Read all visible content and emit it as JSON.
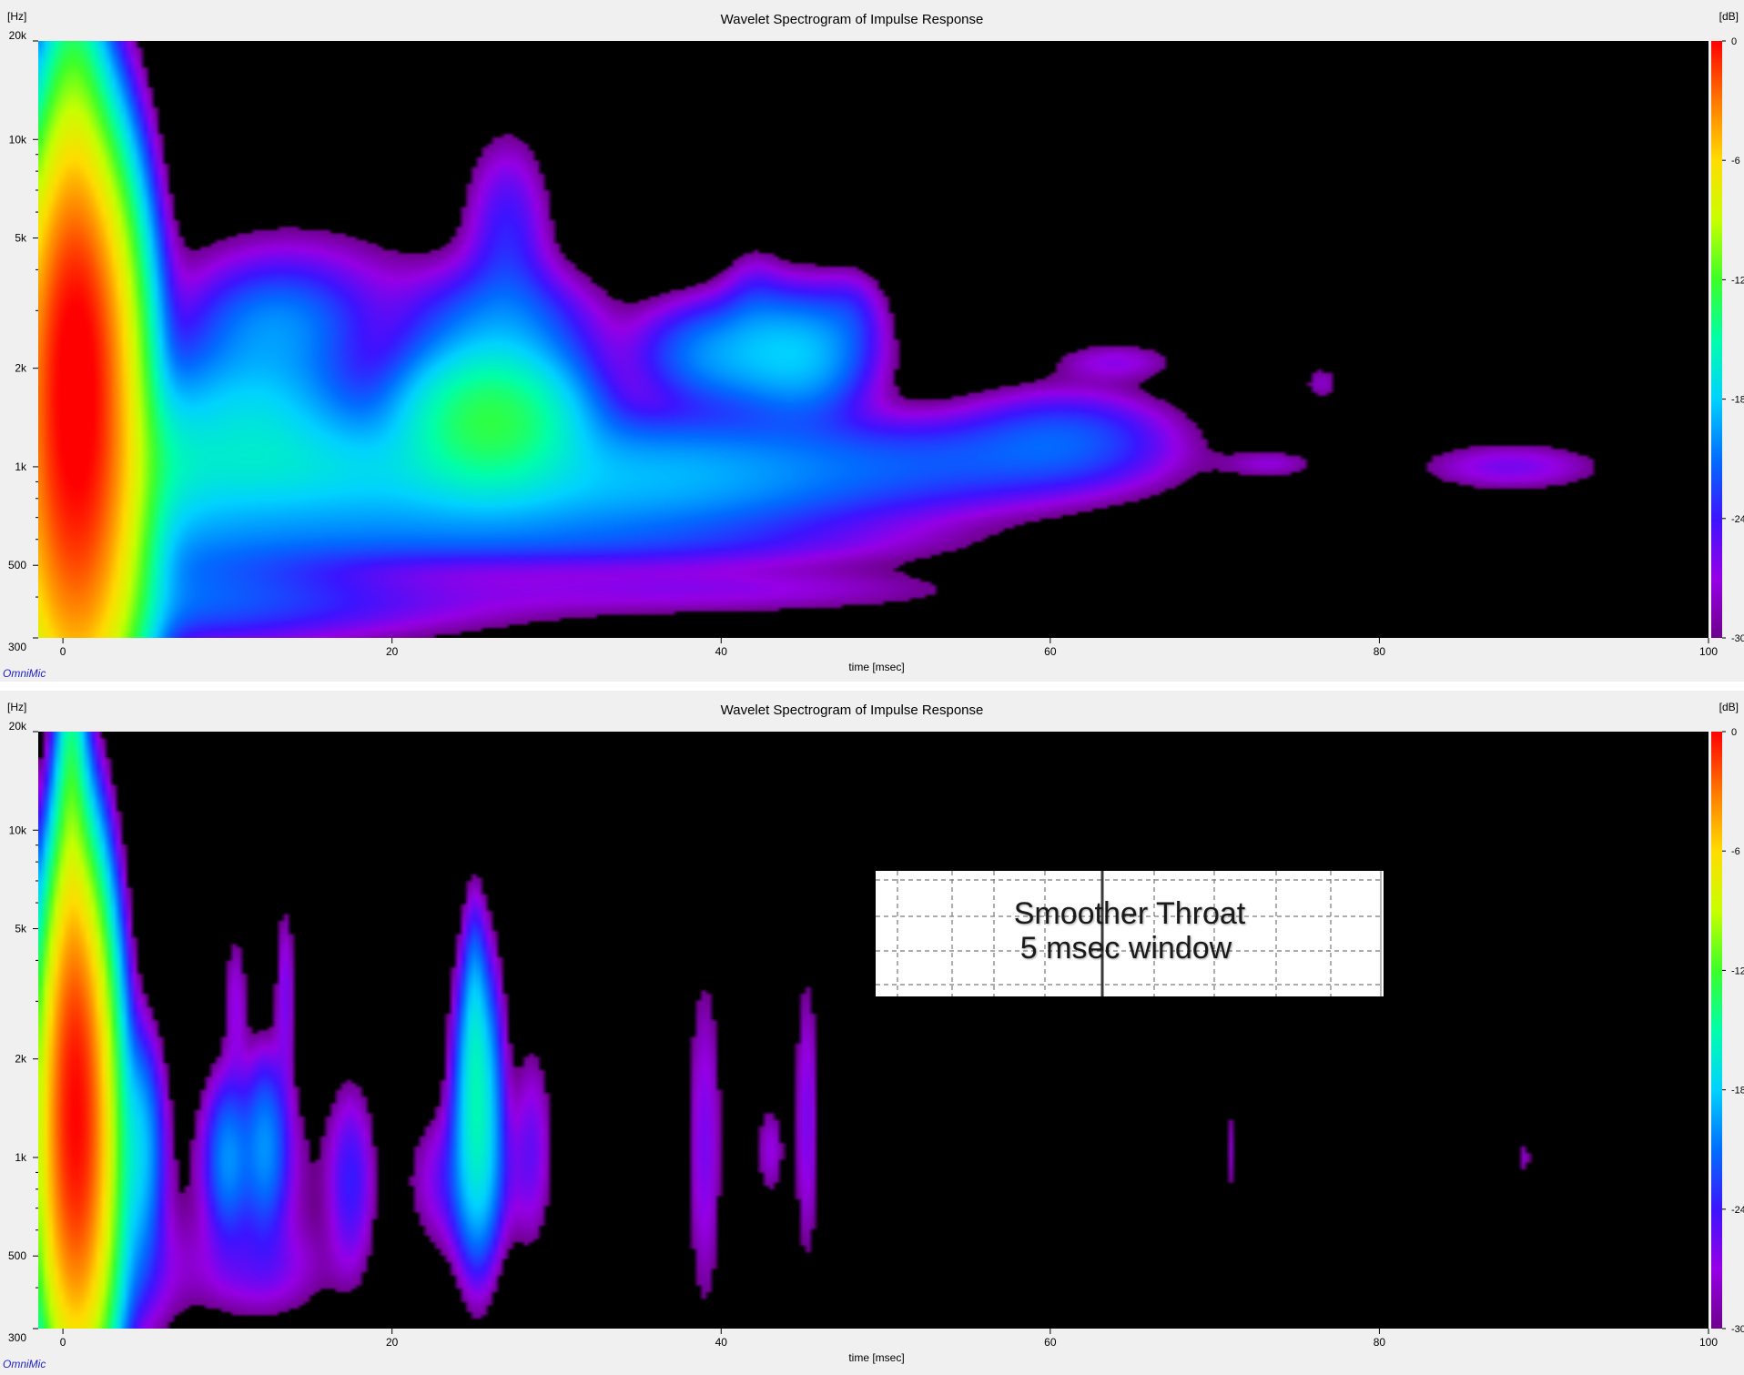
{
  "chart_data": [
    {
      "type": "heatmap",
      "title": "Wavelet Spectrogram of Impulse Response",
      "xlabel": "time [msec]",
      "ylabel": "[Hz]",
      "colorbar_label": "[dB]",
      "xlim": [
        -1.5,
        100
      ],
      "ylim": [
        300,
        20000
      ],
      "yscale": "log",
      "xticks": [
        0,
        20,
        40,
        60,
        80,
        100
      ],
      "yticks": [
        {
          "v": 20000,
          "label": "20k"
        },
        {
          "v": 10000,
          "label": "10k"
        },
        {
          "v": 5000,
          "label": "5k"
        },
        {
          "v": 2000,
          "label": "2k"
        },
        {
          "v": 1000,
          "label": "1k"
        },
        {
          "v": 500,
          "label": "500"
        },
        {
          "v": 300,
          "label": "300"
        }
      ],
      "colorbar_ticks": [
        0,
        -6,
        -12,
        -18,
        -24,
        -30
      ],
      "colorbar_range": [
        -30,
        0
      ],
      "watermark": "OmniMic",
      "features": [
        {
          "t": 0.8,
          "f": 1150,
          "dt": 1.8,
          "df": 0.4,
          "db": -1
        },
        {
          "t": 0.8,
          "f": 2500,
          "dt": 1.6,
          "df": 0.28,
          "db": -3
        },
        {
          "t": 0.8,
          "f": 650,
          "dt": 2.2,
          "df": 0.3,
          "db": -10
        },
        {
          "t": 0.6,
          "f": 5500,
          "dt": 1.2,
          "df": 0.3,
          "db": -10
        },
        {
          "t": 0.6,
          "f": 11000,
          "dt": 0.9,
          "df": 0.35,
          "db": -16
        },
        {
          "t": 3.5,
          "f": 1100,
          "dt": 3.0,
          "df": 0.12,
          "db": -17
        },
        {
          "t": 4.0,
          "f": 800,
          "dt": 5.0,
          "df": 0.1,
          "db": -22
        },
        {
          "t": 5.0,
          "f": 450,
          "dt": 8.0,
          "df": 0.12,
          "db": -22
        },
        {
          "t": 11.5,
          "f": 1450,
          "dt": 3.8,
          "df": 0.14,
          "db": -18
        },
        {
          "t": 14.0,
          "f": 1000,
          "dt": 7.0,
          "df": 0.1,
          "db": -20
        },
        {
          "t": 14.0,
          "f": 3400,
          "dt": 5.0,
          "df": 0.14,
          "db": -26
        },
        {
          "t": 13.0,
          "f": 2700,
          "dt": 3.0,
          "df": 0.1,
          "db": -22
        },
        {
          "t": 18.0,
          "f": 640,
          "dt": 12.0,
          "df": 0.07,
          "db": -24
        },
        {
          "t": 12.0,
          "f": 370,
          "dt": 12.0,
          "df": 0.07,
          "db": -26
        },
        {
          "t": 26.0,
          "f": 1400,
          "dt": 3.2,
          "df": 0.12,
          "db": -13
        },
        {
          "t": 26.5,
          "f": 2600,
          "dt": 3.5,
          "df": 0.12,
          "db": -21
        },
        {
          "t": 25.0,
          "f": 900,
          "dt": 11.0,
          "df": 0.1,
          "db": -21
        },
        {
          "t": 27.0,
          "f": 5200,
          "dt": 1.6,
          "df": 0.18,
          "db": -24
        },
        {
          "t": 37.0,
          "f": 1050,
          "dt": 6.0,
          "df": 0.1,
          "db": -23
        },
        {
          "t": 36.0,
          "f": 780,
          "dt": 10.0,
          "df": 0.08,
          "db": -25
        },
        {
          "t": 40.0,
          "f": 2200,
          "dt": 3.0,
          "df": 0.1,
          "db": -20
        },
        {
          "t": 45.0,
          "f": 2200,
          "dt": 2.5,
          "df": 0.12,
          "db": -19
        },
        {
          "t": 47.0,
          "f": 1000,
          "dt": 10.0,
          "df": 0.1,
          "db": -24
        },
        {
          "t": 55.0,
          "f": 1050,
          "dt": 7.0,
          "df": 0.08,
          "db": -26
        },
        {
          "t": 61.0,
          "f": 1250,
          "dt": 4.0,
          "df": 0.09,
          "db": -23
        },
        {
          "t": 40.0,
          "f": 420,
          "dt": 11.0,
          "df": 0.05,
          "db": -27
        },
        {
          "t": 35.0,
          "f": 580,
          "dt": 12.0,
          "df": 0.05,
          "db": -26
        },
        {
          "t": 64.0,
          "f": 2100,
          "dt": 2.5,
          "df": 0.04,
          "db": -27
        },
        {
          "t": 88.0,
          "f": 1000,
          "dt": 3.8,
          "df": 0.05,
          "db": -26
        },
        {
          "t": 73.5,
          "f": 1020,
          "dt": 2.0,
          "df": 0.03,
          "db": -28
        },
        {
          "t": 76.5,
          "f": 1800,
          "dt": 0.8,
          "df": 0.04,
          "db": -28
        },
        {
          "t": 42.0,
          "f": 3300,
          "dt": 1.2,
          "df": 0.1,
          "db": -27
        },
        {
          "t": 48.0,
          "f": 3000,
          "dt": 1.2,
          "df": 0.08,
          "db": -27
        }
      ]
    },
    {
      "type": "heatmap",
      "title": "Wavelet Spectrogram of Impulse Response",
      "xlabel": "time [msec]",
      "ylabel": "[Hz]",
      "colorbar_label": "[dB]",
      "xlim": [
        -1.5,
        100
      ],
      "ylim": [
        300,
        20000
      ],
      "yscale": "log",
      "xticks": [
        0,
        20,
        40,
        60,
        80,
        100
      ],
      "yticks": [
        {
          "v": 20000,
          "label": "20k"
        },
        {
          "v": 10000,
          "label": "10k"
        },
        {
          "v": 5000,
          "label": "5k"
        },
        {
          "v": 2000,
          "label": "2k"
        },
        {
          "v": 1000,
          "label": "1k"
        },
        {
          "v": 500,
          "label": "500"
        },
        {
          "v": 300,
          "label": "300"
        }
      ],
      "colorbar_ticks": [
        0,
        -6,
        -12,
        -18,
        -24,
        -30
      ],
      "colorbar_range": [
        -30,
        0
      ],
      "watermark": "OmniMic",
      "annotation": [
        "Smoother Throat",
        "5 msec window"
      ],
      "features": [
        {
          "t": 0.8,
          "f": 1150,
          "dt": 1.1,
          "df": 0.35,
          "db": -1
        },
        {
          "t": 0.7,
          "f": 2300,
          "dt": 0.9,
          "df": 0.3,
          "db": -6
        },
        {
          "t": 0.7,
          "f": 600,
          "dt": 1.4,
          "df": 0.25,
          "db": -14
        },
        {
          "t": 0.5,
          "f": 6000,
          "dt": 0.6,
          "df": 0.35,
          "db": -13
        },
        {
          "t": 0.5,
          "f": 13000,
          "dt": 0.4,
          "df": 0.35,
          "db": -17
        },
        {
          "t": 4.5,
          "f": 1050,
          "dt": 0.9,
          "df": 0.2,
          "db": -18
        },
        {
          "t": 2.5,
          "f": 1000,
          "dt": 0.8,
          "df": 0.18,
          "db": -22
        },
        {
          "t": 10.0,
          "f": 1000,
          "dt": 0.8,
          "df": 0.14,
          "db": -21
        },
        {
          "t": 12.3,
          "f": 1100,
          "dt": 0.8,
          "df": 0.16,
          "db": -21
        },
        {
          "t": 11.5,
          "f": 900,
          "dt": 2.5,
          "df": 0.2,
          "db": -26
        },
        {
          "t": 17.5,
          "f": 850,
          "dt": 0.9,
          "df": 0.18,
          "db": -24
        },
        {
          "t": 25.2,
          "f": 1400,
          "dt": 0.8,
          "df": 0.25,
          "db": -16
        },
        {
          "t": 25.0,
          "f": 2600,
          "dt": 0.4,
          "df": 0.2,
          "db": -21
        },
        {
          "t": 24.5,
          "f": 850,
          "dt": 2.0,
          "df": 0.14,
          "db": -24
        },
        {
          "t": 28.5,
          "f": 1100,
          "dt": 0.8,
          "df": 0.2,
          "db": -26
        },
        {
          "t": 39.0,
          "f": 1100,
          "dt": 0.7,
          "df": 0.35,
          "db": -26
        },
        {
          "t": 45.2,
          "f": 1300,
          "dt": 0.5,
          "df": 0.3,
          "db": -26
        },
        {
          "t": 43.0,
          "f": 1050,
          "dt": 0.6,
          "df": 0.1,
          "db": -27
        },
        {
          "t": 71.0,
          "f": 1050,
          "dt": 0.3,
          "df": 0.1,
          "db": -28
        },
        {
          "t": 88.8,
          "f": 1000,
          "dt": 0.3,
          "df": 0.04,
          "db": -28
        },
        {
          "t": 13.5,
          "f": 3200,
          "dt": 0.4,
          "df": 0.18,
          "db": -26
        },
        {
          "t": 10.5,
          "f": 3000,
          "dt": 0.5,
          "df": 0.15,
          "db": -27
        },
        {
          "t": 3.0,
          "f": 450,
          "dt": 2.5,
          "df": 0.15,
          "db": -24
        },
        {
          "t": 12.0,
          "f": 450,
          "dt": 3.0,
          "df": 0.1,
          "db": -27
        }
      ]
    }
  ]
}
